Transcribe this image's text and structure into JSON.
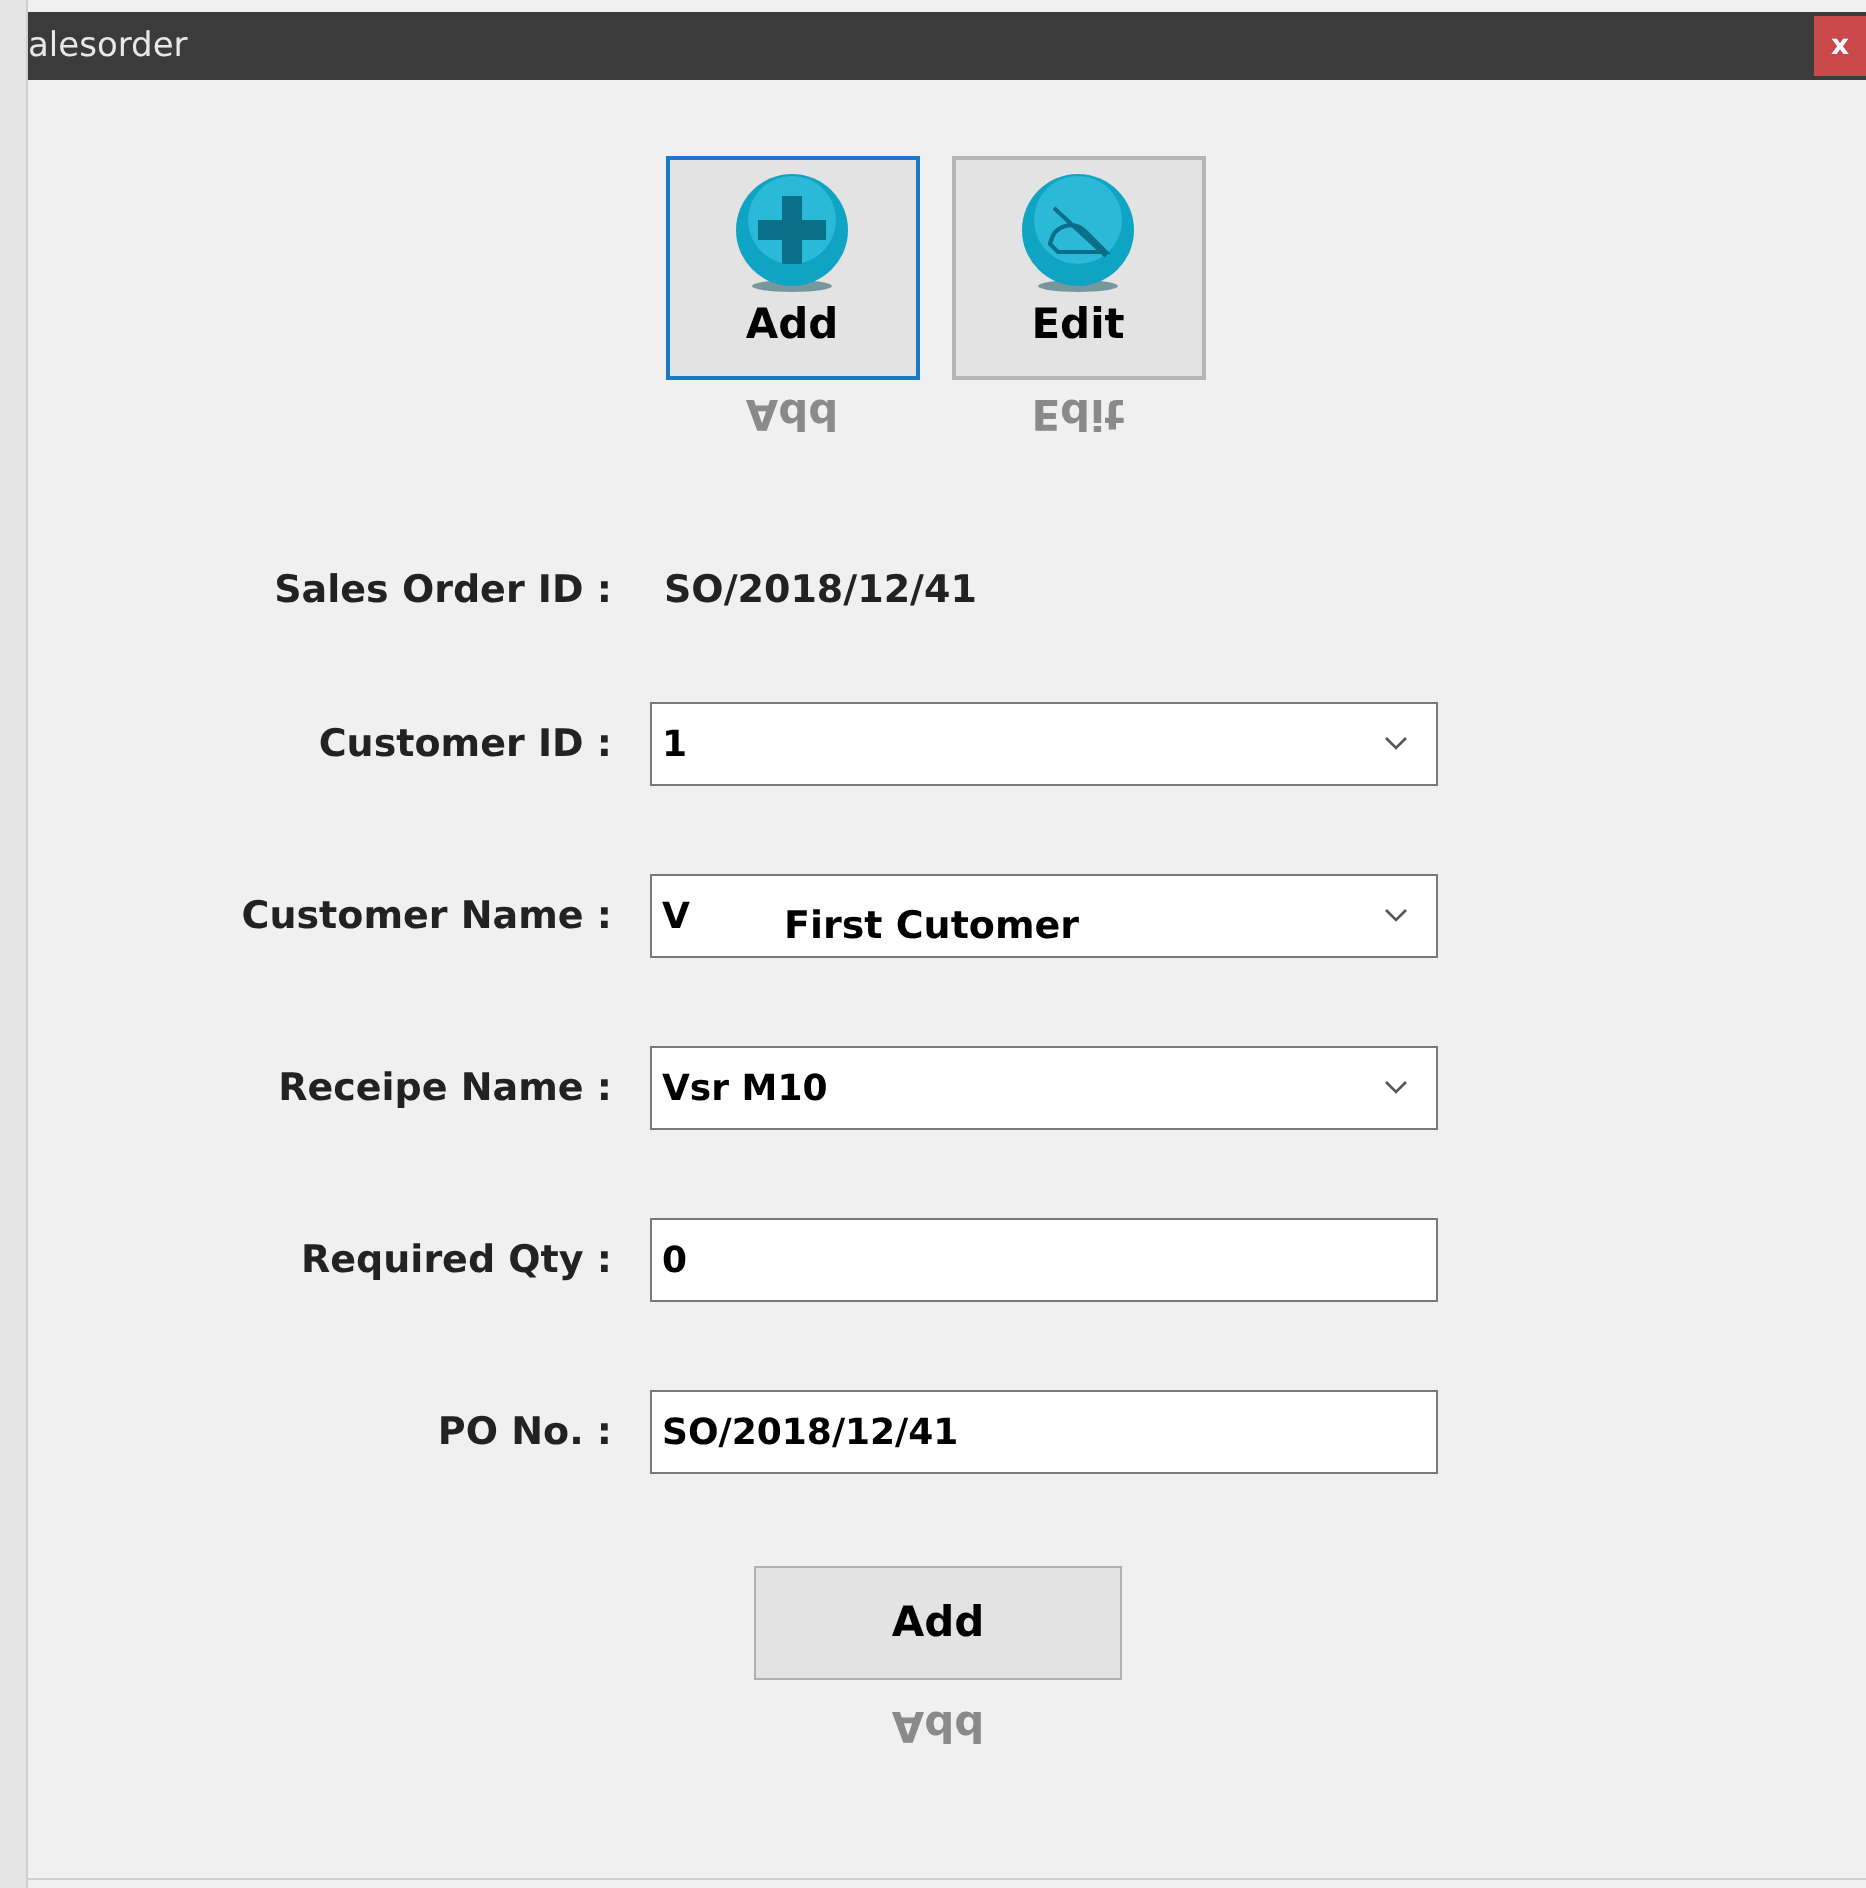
{
  "window": {
    "title": "alesorder",
    "close": "x"
  },
  "toolbar": [
    {
      "label": "Add",
      "reflection": "Add",
      "selected": true
    },
    {
      "label": "Edit",
      "reflection": "Edit",
      "selected": false
    }
  ],
  "form": [
    {
      "kind": "text",
      "label": "Sales Order ID :",
      "value": "SO/2018/12/41"
    },
    {
      "kind": "combo",
      "label": "Customer ID :",
      "value": "1"
    },
    {
      "kind": "combo",
      "label": "Customer Name :",
      "value": "V",
      "overlay": "First Cutomer"
    },
    {
      "kind": "combo",
      "label": "Receipe Name :",
      "value": "Vsr M10"
    },
    {
      "kind": "input",
      "label": "Required Qty :",
      "value": "0"
    },
    {
      "kind": "input",
      "label": "PO No. :",
      "value": "SO/2018/12/41"
    }
  ],
  "submit": {
    "label": "Add",
    "reflection": "Add"
  }
}
